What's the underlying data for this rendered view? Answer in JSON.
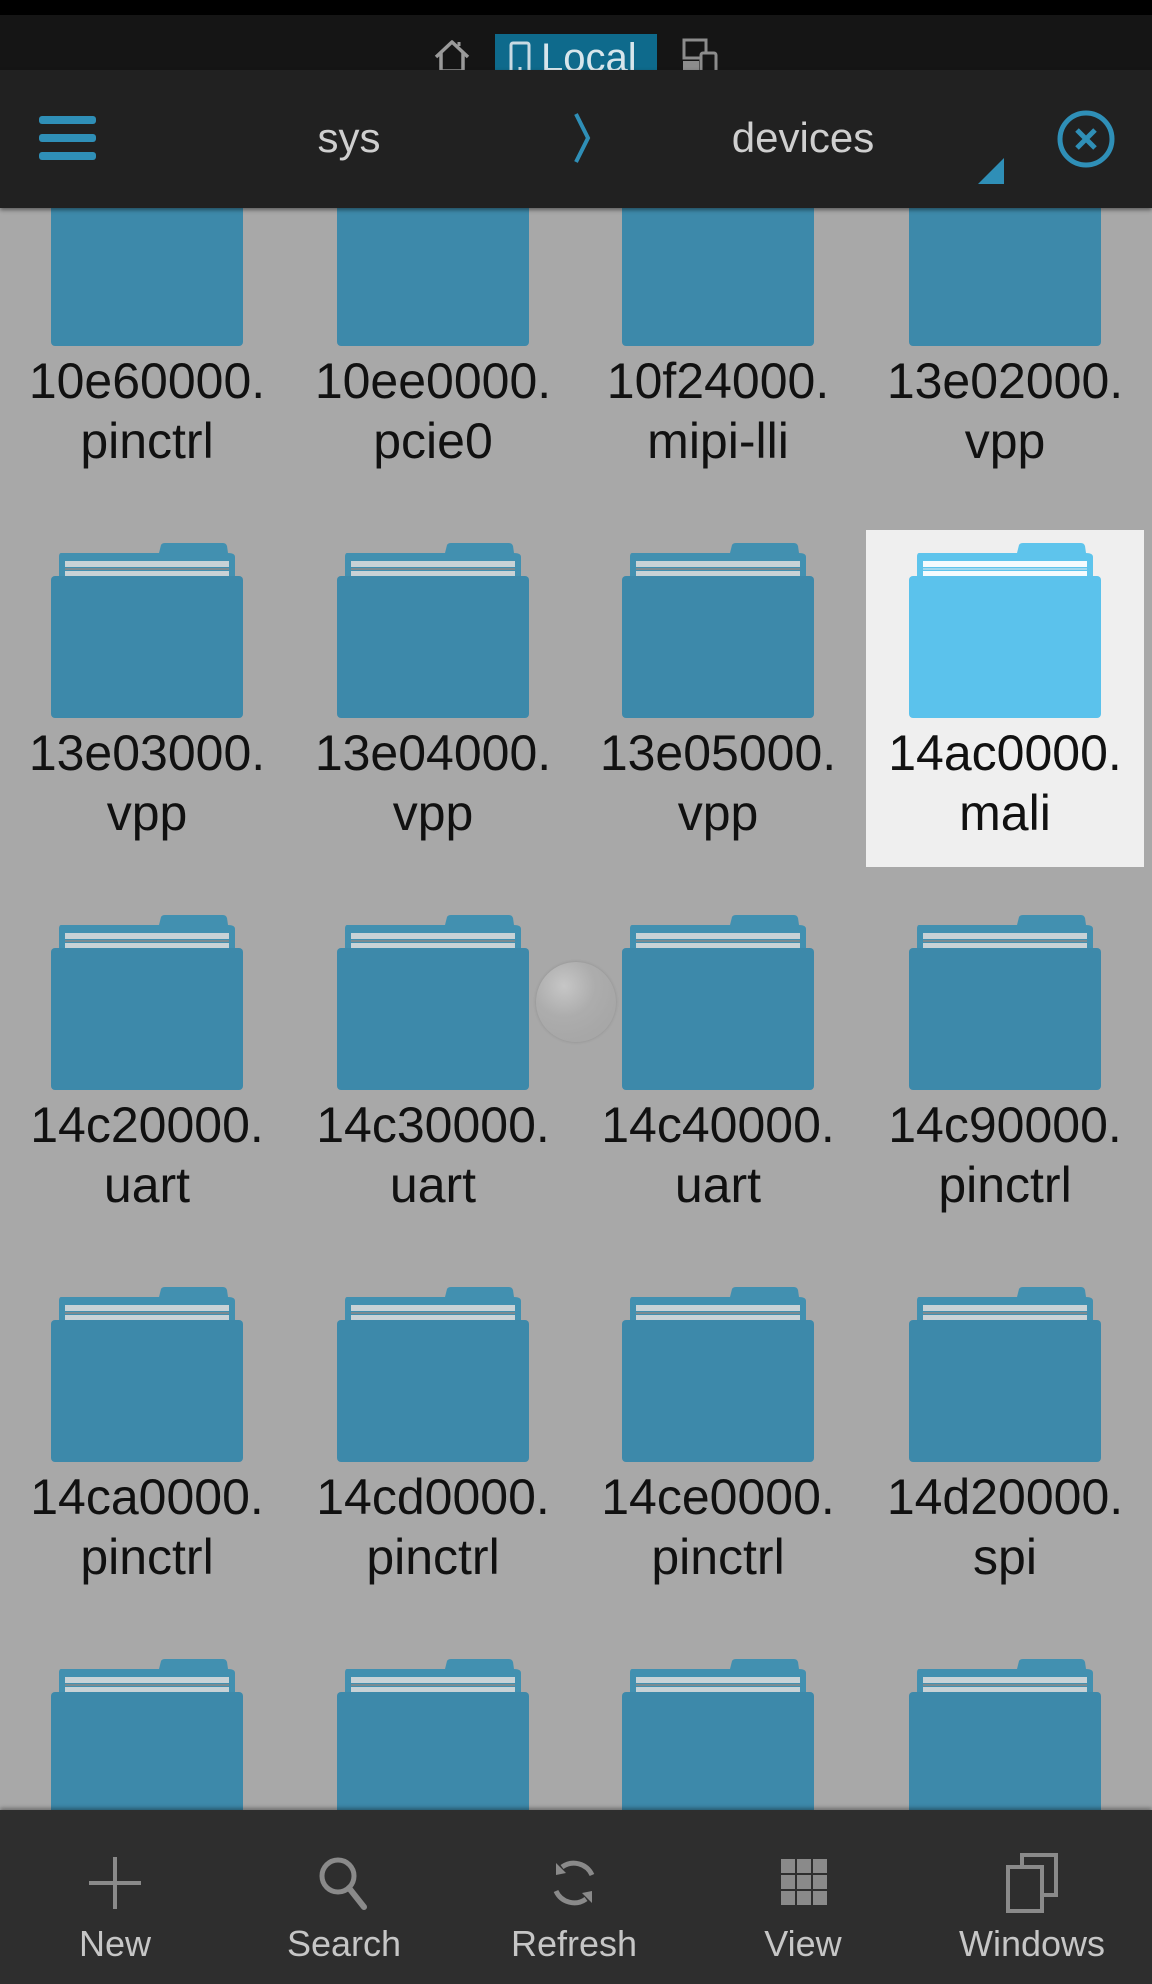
{
  "statusbar": {
    "home_icon": "home-icon",
    "location_label": "Local",
    "location_icon": "phone-icon",
    "devices_icon": "devices-icon"
  },
  "header": {
    "menu_icon": "hamburger-icon",
    "breadcrumb": [
      "sys",
      "devices"
    ],
    "separator_icon": "chevron-right-icon",
    "dropdown_icon": "dropdown-triangle-icon",
    "close_icon": "close-circle-icon"
  },
  "colors": {
    "accent": "#2f8fb7",
    "folder": "#3d89aa",
    "folder_selected": "#5bc2ec",
    "background": "#a8a8a8",
    "header_bg": "#212121",
    "toolbar_bg": "#2e2e2e",
    "local_button_bg": "#0e6a8c"
  },
  "files": [
    {
      "line1": "10e60000.",
      "line2": "pinctrl",
      "selected": false
    },
    {
      "line1": "10ee0000.",
      "line2": "pcie0",
      "selected": false
    },
    {
      "line1": "10f24000.",
      "line2": "mipi-lli",
      "selected": false
    },
    {
      "line1": "13e02000.",
      "line2": "vpp",
      "selected": false
    },
    {
      "line1": "13e03000.",
      "line2": "vpp",
      "selected": false
    },
    {
      "line1": "13e04000.",
      "line2": "vpp",
      "selected": false
    },
    {
      "line1": "13e05000.",
      "line2": "vpp",
      "selected": false
    },
    {
      "line1": "14ac0000.",
      "line2": "mali",
      "selected": true
    },
    {
      "line1": "14c20000.",
      "line2": "uart",
      "selected": false
    },
    {
      "line1": "14c30000.",
      "line2": "uart",
      "selected": false
    },
    {
      "line1": "14c40000.",
      "line2": "uart",
      "selected": false
    },
    {
      "line1": "14c90000.",
      "line2": "pinctrl",
      "selected": false
    },
    {
      "line1": "14ca0000.",
      "line2": "pinctrl",
      "selected": false
    },
    {
      "line1": "14cd0000.",
      "line2": "pinctrl",
      "selected": false
    },
    {
      "line1": "14ce0000.",
      "line2": "pinctrl",
      "selected": false
    },
    {
      "line1": "14d20000.",
      "line2": "spi",
      "selected": false
    },
    {
      "line1": "",
      "line2": "",
      "selected": false
    },
    {
      "line1": "",
      "line2": "",
      "selected": false
    },
    {
      "line1": "",
      "line2": "",
      "selected": false
    },
    {
      "line1": "",
      "line2": "",
      "selected": false
    }
  ],
  "toolbar": [
    {
      "label": "New",
      "icon": "plus-icon"
    },
    {
      "label": "Search",
      "icon": "search-icon"
    },
    {
      "label": "Refresh",
      "icon": "refresh-icon"
    },
    {
      "label": "View",
      "icon": "grid-view-icon"
    },
    {
      "label": "Windows",
      "icon": "windows-icon"
    }
  ]
}
